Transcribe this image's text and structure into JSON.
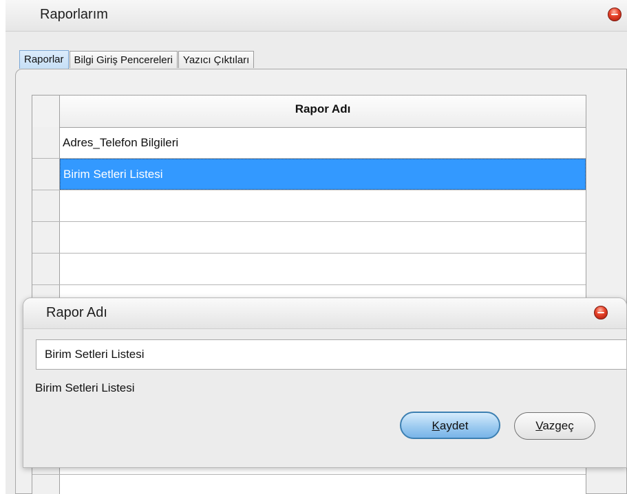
{
  "window": {
    "title": "Raporlarım"
  },
  "tabs": [
    {
      "label": "Raporlar",
      "active": true
    },
    {
      "label": "Bilgi Giriş Pencereleri",
      "active": false
    },
    {
      "label": "Yazıcı Çıktıları",
      "active": false
    }
  ],
  "grid": {
    "column_header": "Rapor Adı",
    "rows": [
      {
        "value": "Adres_Telefon Bilgileri",
        "selected": false
      },
      {
        "value": "Birim Setleri Listesi",
        "selected": true
      },
      {
        "value": "",
        "selected": false
      },
      {
        "value": "",
        "selected": false
      },
      {
        "value": "",
        "selected": false
      },
      {
        "value": "",
        "selected": false
      },
      {
        "value": "",
        "selected": false
      },
      {
        "value": "",
        "selected": false
      },
      {
        "value": "",
        "selected": false
      },
      {
        "value": "",
        "selected": false
      },
      {
        "value": "",
        "selected": false
      },
      {
        "value": "",
        "selected": false
      }
    ]
  },
  "dialog": {
    "title": "Rapor Adı",
    "input_value": "Birim Setleri Listesi",
    "label": "Birim Setleri Listesi",
    "save_button": {
      "accel": "K",
      "rest": "aydet"
    },
    "cancel_button": {
      "accel": "V",
      "rest": "azgeç"
    }
  },
  "colors": {
    "selection": "#3399ff",
    "close_button": "#e8452c",
    "default_button": "#9dcbf0"
  },
  "icons": {
    "window_close": "close-icon",
    "dialog_close": "close-icon"
  }
}
